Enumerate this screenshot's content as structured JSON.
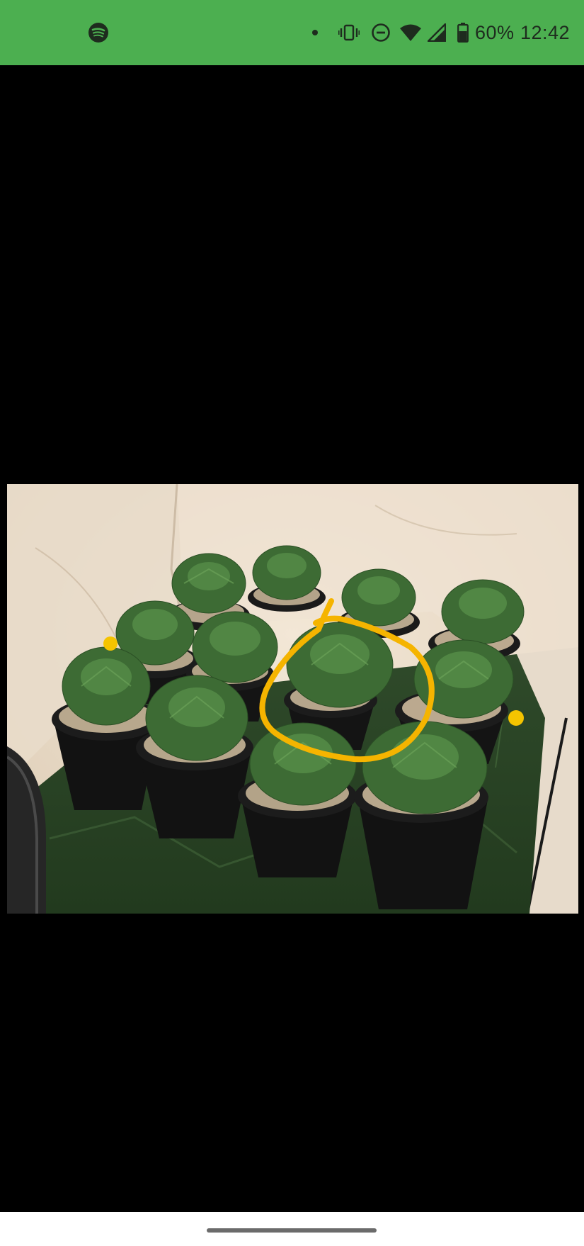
{
  "status_bar": {
    "background": "#4caf50",
    "left_icons": [
      "spotify-icon"
    ],
    "right_icons": [
      "notification-dot-icon",
      "vibrate-icon",
      "do-not-disturb-icon",
      "wifi-icon",
      "cell-signal-icon",
      "battery-icon"
    ],
    "battery_percent": "60%",
    "time": "12:42"
  },
  "viewer": {
    "background": "#000000",
    "photo": {
      "subject": "potted-plants-in-grow-tent",
      "annotation_color": "#f5b400"
    }
  },
  "nav_bar": {
    "background": "#ffffff",
    "handle": "home-gesture-handle"
  }
}
